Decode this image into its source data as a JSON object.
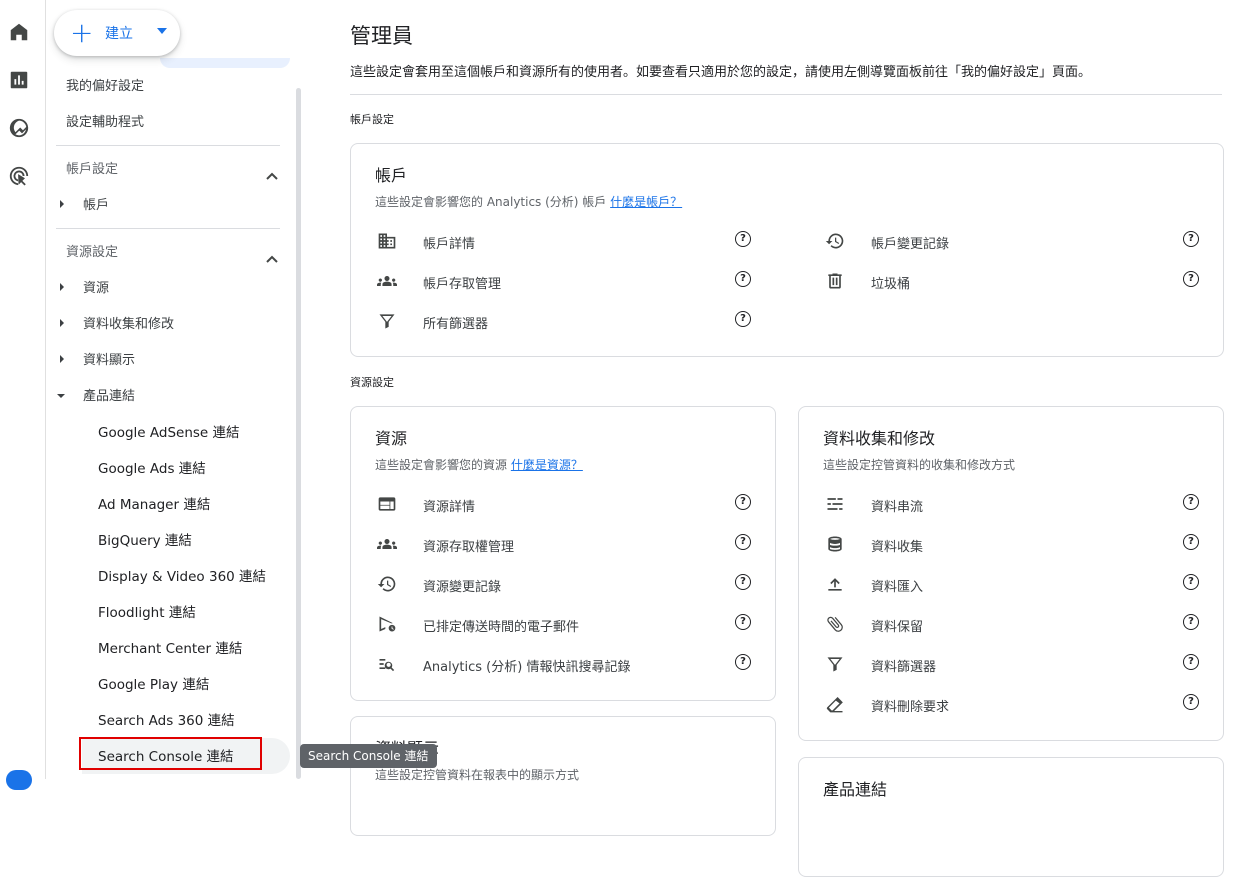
{
  "rail": {
    "icons": [
      "home-icon",
      "reports-icon",
      "explore-icon",
      "advertising-icon"
    ]
  },
  "sidebar": {
    "create_label": "建立",
    "top_items": [
      "我的偏好設定",
      "設定輔助程式"
    ],
    "account_section": {
      "label": "帳戶設定",
      "items": [
        "帳戶"
      ]
    },
    "property_section": {
      "label": "資源設定",
      "items": [
        "資源",
        "資料收集和修改",
        "資料顯示",
        "產品連結"
      ],
      "product_links": [
        "Google AdSense 連結",
        "Google Ads 連結",
        "Ad Manager 連結",
        "BigQuery 連結",
        "Display & Video 360 連結",
        "Floodlight 連結",
        "Merchant Center 連結",
        "Google Play 連結",
        "Search Ads 360 連結",
        "Search Console 連結"
      ]
    }
  },
  "tooltip": "Search Console 連結",
  "main": {
    "title": "管理員",
    "description": "這些設定會套用至這個帳戶和資源所有的使用者。如要查看只適用於您的設定，請使用左側導覽面板前往「我的偏好設定」頁面。",
    "account_settings_label": "帳戶設定",
    "property_settings_label": "資源設定",
    "account_card": {
      "title": "帳戶",
      "subtitle": "這些設定會影響您的 Analytics (分析) 帳戶",
      "subtitle_link": "什麼是帳戶？",
      "left_items": [
        {
          "icon": "building-icon",
          "label": "帳戶詳情"
        },
        {
          "icon": "people-icon",
          "label": "帳戶存取管理"
        },
        {
          "icon": "filter-icon",
          "label": "所有篩選器"
        }
      ],
      "right_items": [
        {
          "icon": "history-icon",
          "label": "帳戶變更記錄"
        },
        {
          "icon": "trash-icon",
          "label": "垃圾桶"
        }
      ]
    },
    "property_card": {
      "title": "資源",
      "subtitle": "這些設定會影響您的資源",
      "subtitle_link": "什麼是資源？",
      "items": [
        {
          "icon": "web-icon",
          "label": "資源詳情"
        },
        {
          "icon": "people-icon",
          "label": "資源存取權管理"
        },
        {
          "icon": "history-icon",
          "label": "資源變更記錄"
        },
        {
          "icon": "scheduled-send-icon",
          "label": "已排定傳送時間的電子郵件"
        },
        {
          "icon": "search-list-icon",
          "label": "Analytics (分析) 情報快訊搜尋記錄"
        }
      ]
    },
    "data_card": {
      "title": "資料收集和修改",
      "subtitle": "這些設定控管資料的收集和修改方式",
      "items": [
        {
          "icon": "stream-icon",
          "label": "資料串流"
        },
        {
          "icon": "database-icon",
          "label": "資料收集"
        },
        {
          "icon": "upload-icon",
          "label": "資料匯入"
        },
        {
          "icon": "paperclip-icon",
          "label": "資料保留"
        },
        {
          "icon": "filter-icon",
          "label": "資料篩選器"
        },
        {
          "icon": "eraser-icon",
          "label": "資料刪除要求"
        }
      ]
    },
    "display_card": {
      "title": "資料顯示",
      "subtitle": "這些設定控管資料在報表中的顯示方式"
    },
    "links_card": {
      "title": "產品連結"
    },
    "help_glyph": "?"
  }
}
